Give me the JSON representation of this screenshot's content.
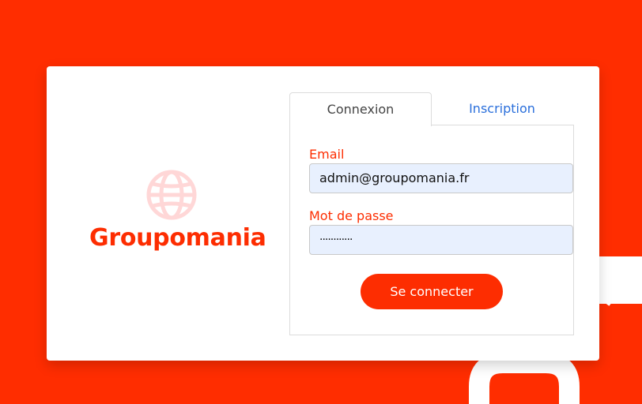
{
  "brand": {
    "name": "Groupomania",
    "icon": "globe-icon",
    "primary_color": "#fd2d01",
    "icon_color": "#ffd7d7"
  },
  "tabs": {
    "login": "Connexion",
    "signup": "Inscription"
  },
  "form": {
    "email_label": "Email",
    "email_value": "admin@groupomania.fr",
    "password_label": "Mot de passe",
    "password_value": "············",
    "submit_label": "Se connecter"
  },
  "colors": {
    "background": "#ff2d00",
    "card": "#ffffff",
    "input_fill": "#e8f0fe",
    "link": "#2a6fdb"
  }
}
